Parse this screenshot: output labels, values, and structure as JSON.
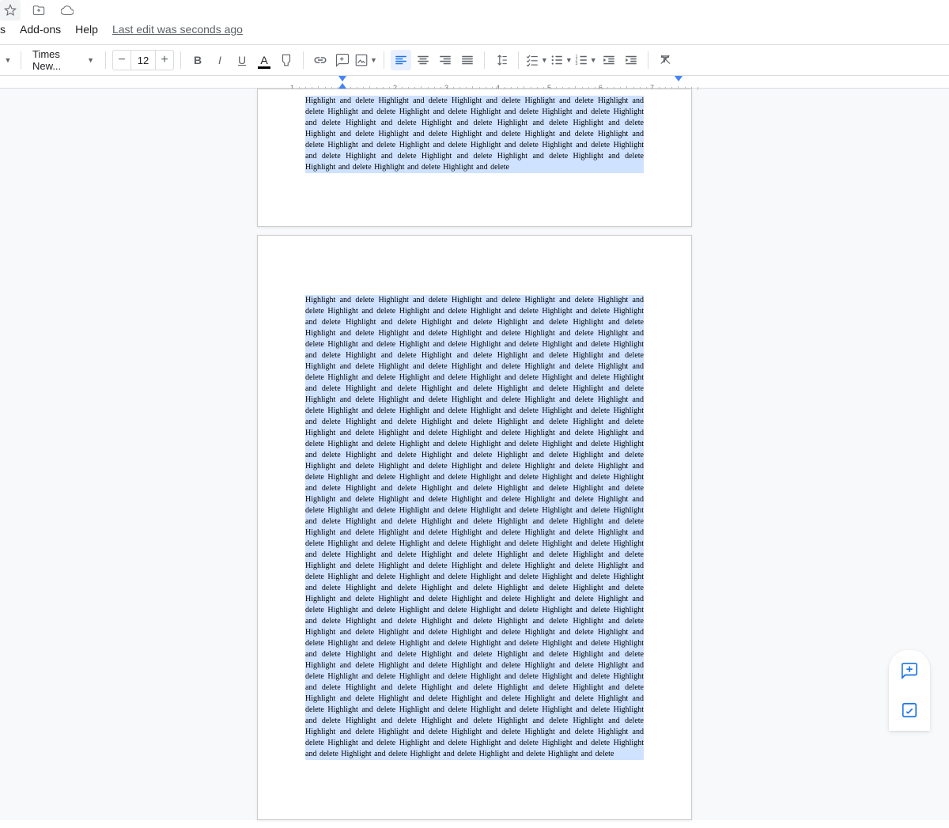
{
  "menu": {
    "items": [
      "s",
      "Add-ons",
      "Help"
    ],
    "last_edit": "Last edit was seconds ago"
  },
  "toolbar": {
    "font_name": "Times New...",
    "font_size": "12",
    "minus": "−",
    "plus": "+",
    "bold": "B",
    "italic": "I",
    "underline": "U",
    "text_color": "A"
  },
  "ruler": {
    "numbers": [
      "1",
      "1",
      "2",
      "3",
      "4",
      "5",
      "6",
      "7"
    ]
  },
  "document": {
    "repeated_phrase": "Highlight and delete ",
    "page1_repeats": 31,
    "page2_repeats": 196
  }
}
